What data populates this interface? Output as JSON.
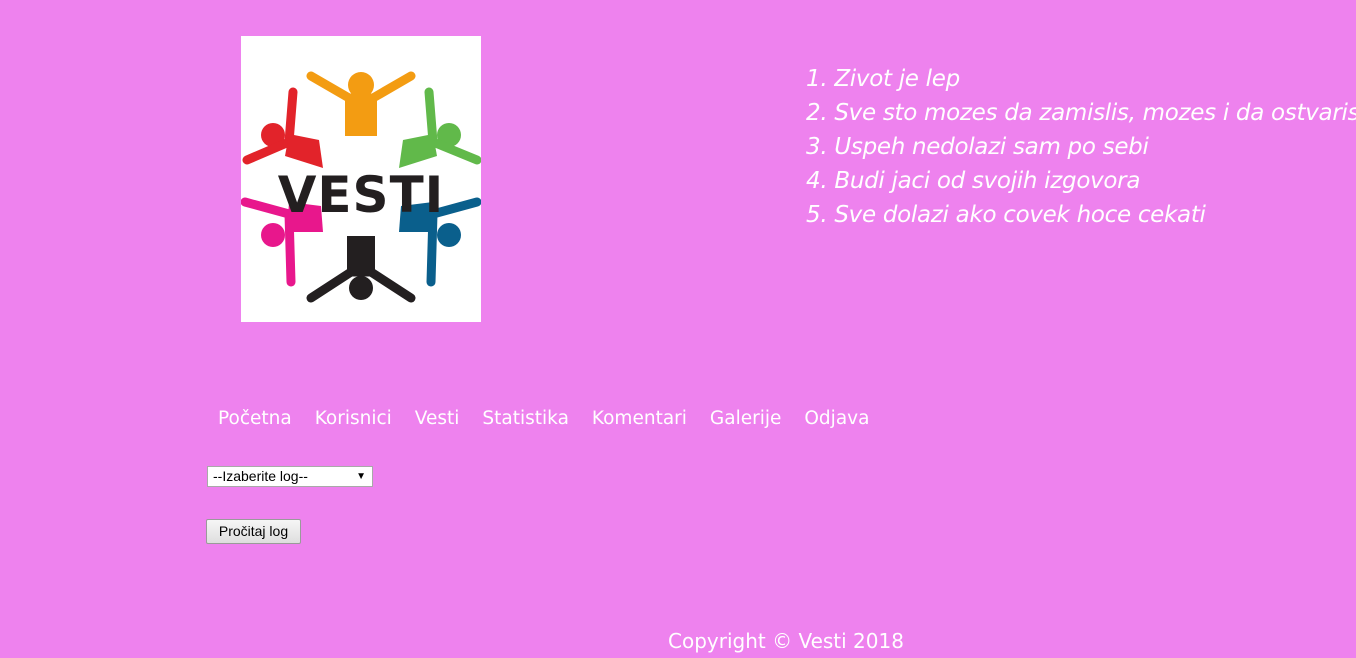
{
  "logo": {
    "text": "VESTI",
    "colors": {
      "orange": "#f39c12",
      "red": "#e2232a",
      "green": "#61b94a",
      "magenta": "#e8178c",
      "blue": "#0a5f8c",
      "dark": "#231f20"
    }
  },
  "quotes": [
    "1. Zivot je lep",
    "2. Sve sto mozes da zamislis, mozes i da ostvaris",
    "3. Uspeh nedolazi sam po sebi",
    "4. Budi jaci od svojih izgovora",
    "5. Sve dolazi ako covek hoce cekati"
  ],
  "nav": [
    {
      "label": "Početna"
    },
    {
      "label": "Korisnici"
    },
    {
      "label": "Vesti"
    },
    {
      "label": "Statistika"
    },
    {
      "label": "Komentari"
    },
    {
      "label": "Galerije"
    },
    {
      "label": "Odjava"
    }
  ],
  "log_select": {
    "selected": "--Izaberite log--"
  },
  "read_button": {
    "label": "Pročitaj log"
  },
  "footer": {
    "text": "Copyright © Vesti 2018"
  },
  "theme": {
    "background": "#ee82ee",
    "text": "#ffffff"
  }
}
